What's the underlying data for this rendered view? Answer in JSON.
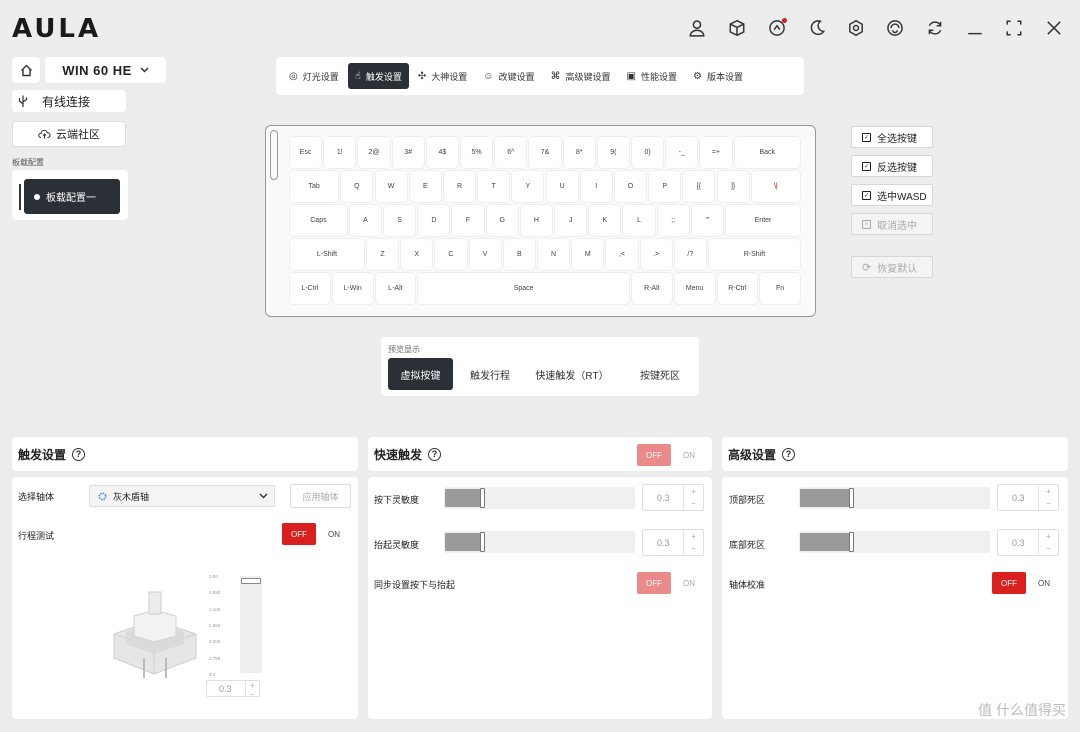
{
  "app": {
    "logo_text": "AULA",
    "device": "WIN 60 HE",
    "connection": "有线连接",
    "cloud": "云端社区",
    "profile_label": "板载配置",
    "profile_item": "板载配置一"
  },
  "titlebar_icons": [
    "user-icon",
    "cube-icon",
    "rocket-icon",
    "moon-icon",
    "settings-hex-icon",
    "swirl-icon",
    "refresh-icon",
    "minimize-icon",
    "maximize-icon",
    "close-icon"
  ],
  "tabs": [
    {
      "label": "灯光设置",
      "icon": "light-icon",
      "active": false
    },
    {
      "label": "触发设置",
      "icon": "trigger-icon",
      "active": true
    },
    {
      "label": "大神设置",
      "icon": "macro-icon",
      "active": false
    },
    {
      "label": "改键设置",
      "icon": "remap-icon",
      "active": false
    },
    {
      "label": "高级键设置",
      "icon": "advanced-key-icon",
      "active": false
    },
    {
      "label": "性能设置",
      "icon": "chip-icon",
      "active": false
    },
    {
      "label": "版本设置",
      "icon": "version-icon",
      "active": false
    }
  ],
  "keyboard": {
    "rows": [
      [
        [
          "Esc",
          1
        ],
        [
          "1!",
          1
        ],
        [
          "2@",
          1
        ],
        [
          "3#",
          1
        ],
        [
          "4$",
          1
        ],
        [
          "5%",
          1
        ],
        [
          "6^",
          1
        ],
        [
          "7&",
          1
        ],
        [
          "8*",
          1
        ],
        [
          "9(",
          1
        ],
        [
          "0)",
          1
        ],
        [
          "-_",
          1
        ],
        [
          "=+",
          1
        ],
        [
          "Back",
          2
        ]
      ],
      [
        [
          "Tab",
          1.5
        ],
        [
          "Q",
          1
        ],
        [
          "W",
          1
        ],
        [
          "E",
          1
        ],
        [
          "R",
          1
        ],
        [
          "T",
          1
        ],
        [
          "Y",
          1
        ],
        [
          "U",
          1
        ],
        [
          "I",
          1
        ],
        [
          "O",
          1
        ],
        [
          "P",
          1
        ],
        [
          "[{",
          1
        ],
        [
          "]}",
          1
        ],
        [
          "\\|",
          1.5
        ]
      ],
      [
        [
          "Caps",
          1.75
        ],
        [
          "A",
          1
        ],
        [
          "S",
          1
        ],
        [
          "D",
          1
        ],
        [
          "F",
          1
        ],
        [
          "G",
          1
        ],
        [
          "H",
          1
        ],
        [
          "J",
          1
        ],
        [
          "K",
          1
        ],
        [
          "L",
          1
        ],
        [
          ";:",
          1
        ],
        [
          "'\"",
          1
        ],
        [
          "Enter",
          2.25
        ]
      ],
      [
        [
          "L-Shift",
          2.25
        ],
        [
          "Z",
          1
        ],
        [
          "X",
          1
        ],
        [
          "C",
          1
        ],
        [
          "V",
          1
        ],
        [
          "B",
          1
        ],
        [
          "N",
          1
        ],
        [
          "M",
          1
        ],
        [
          ",<",
          1
        ],
        [
          ".>",
          1
        ],
        [
          "/?",
          1
        ],
        [
          "R-Shift",
          2.75
        ]
      ],
      [
        [
          "L-Ctrl",
          1.25
        ],
        [
          "L-Win",
          1.25
        ],
        [
          "L-Alt",
          1.25
        ],
        [
          "Space",
          6.25
        ],
        [
          "R-Alt",
          1.25
        ],
        [
          "Menu",
          1.25
        ],
        [
          "R-Ctrl",
          1.25
        ],
        [
          "Fn",
          1.25
        ]
      ]
    ]
  },
  "side_buttons": [
    {
      "label": "全选按键",
      "enabled": true
    },
    {
      "label": "反选按键",
      "enabled": true
    },
    {
      "label": "选中WASD",
      "enabled": true
    },
    {
      "label": "取消选中",
      "enabled": false
    },
    {
      "label": "恢复默认",
      "enabled": false
    }
  ],
  "preview": {
    "label": "预览显示",
    "options": [
      {
        "label": "虚拟按键",
        "active": true
      },
      {
        "label": "触发行程",
        "active": false
      },
      {
        "label": "快速触发（RT）",
        "active": false
      },
      {
        "label": "按键死区",
        "active": false
      }
    ]
  },
  "trigger_panel": {
    "title": "触发设置",
    "switch_label": "选择轴体",
    "switch_value": "灰木盾轴",
    "apply_label": "应用轴体",
    "travel_test_label": "行程测试",
    "travel_test": "OFF",
    "off_label": "OFF",
    "on_label": "ON",
    "scale": [
      "0.00",
      "0.550",
      "1.100",
      "1.650",
      "2.200",
      "2.750",
      "3.4"
    ],
    "value": "0.3",
    "plus": "+",
    "minus": "−"
  },
  "rt_panel": {
    "title": "快速触发",
    "state": "OFF",
    "off_label": "OFF",
    "on_label": "ON",
    "press_label": "按下灵敏度",
    "press_value": "0.3",
    "press_level": 0.2,
    "release_label": "抬起灵敏度",
    "release_value": "0.3",
    "release_level": 0.2,
    "sync_label": "同步设置按下与抬起",
    "sync_off": "OFF",
    "sync_on": "ON",
    "plus": "+",
    "minus": "−"
  },
  "adv_panel": {
    "title": "高级设置",
    "top_dead_label": "顶部死区",
    "top_dead_value": "0.3",
    "top_dead_level": 0.27,
    "bottom_dead_label": "底部死区",
    "bottom_dead_value": "0.3",
    "bottom_dead_level": 0.27,
    "calib_label": "轴体校准",
    "calib_off": "OFF",
    "calib_on": "ON",
    "plus": "+",
    "minus": "−"
  },
  "watermark": "值 什么值得买",
  "colors": {
    "dark": "#2b3036",
    "red": "#d9201f",
    "red_dim": "#ec8a8a"
  }
}
